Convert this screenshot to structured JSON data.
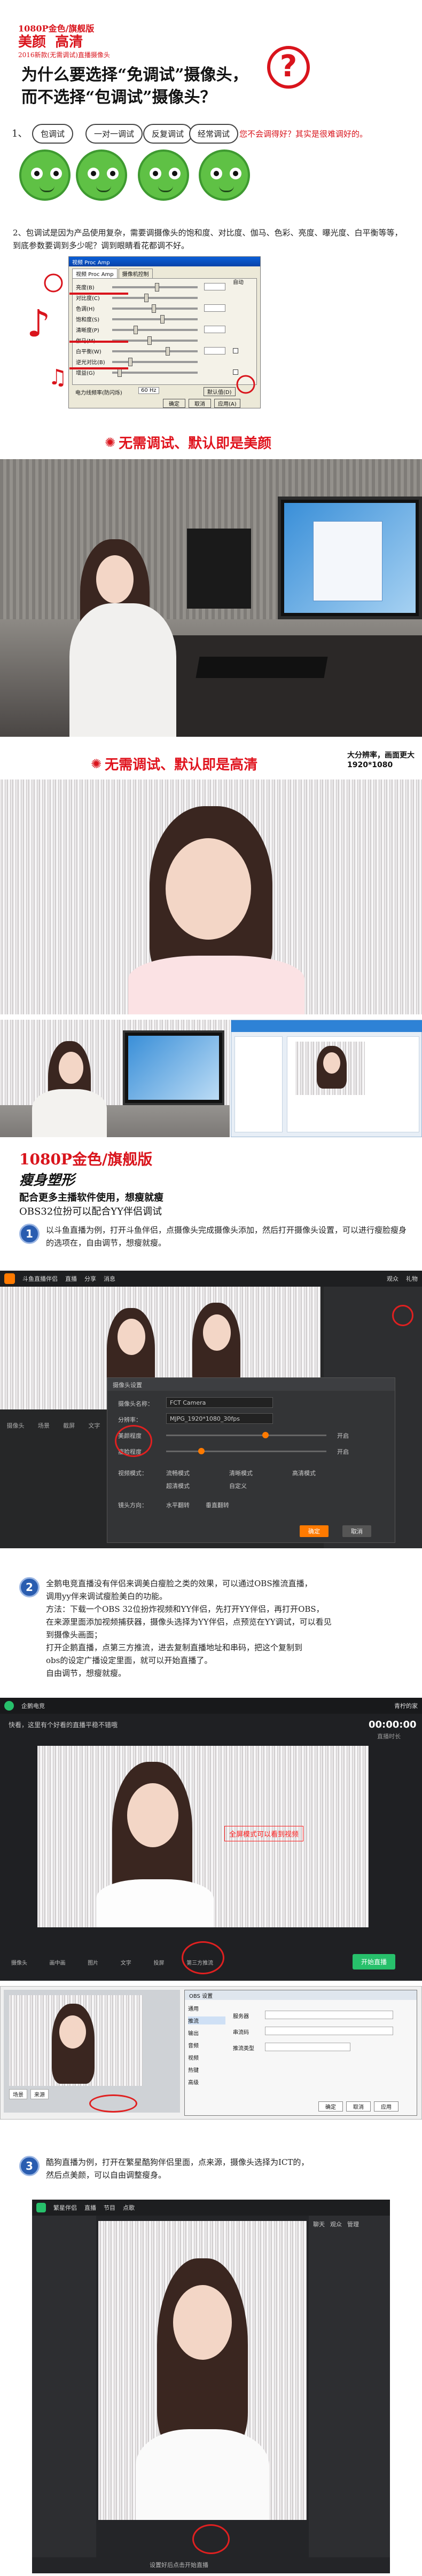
{
  "header": {
    "tag_line1": "1080P金色/旗舰版",
    "tag_line2_a": "美颜",
    "tag_line2_b": "高清",
    "tag_line3": "2016新款(无需调试)直播摄像头",
    "question_line1": "为什么要选择“免调试”摄像头，",
    "question_line2": "而不选择“包调试”摄像头？",
    "question_mark": "?"
  },
  "point1": {
    "number": "1、",
    "bubbles": [
      "包调试",
      "一对一调试",
      "反复调试",
      "经常调试"
    ],
    "side_text": "您不会调得好？其实是很难调好的。"
  },
  "point2": {
    "text": "2、包调试是因为产品使用复杂，需要调摄像头的饱和度、对比度、伽马、色彩、亮度、曝光度、白平衡等等，到底参数要调到多少呢？调到眼睛看花都调不好。"
  },
  "props_dialog": {
    "title": "视频 Proc Amp",
    "tabs": [
      "视频 Proc Amp",
      "摄像机控制"
    ],
    "rows": [
      "亮度(B)",
      "对比度(C)",
      "色调(H)",
      "饱和度(S)",
      "清晰度(P)",
      "伽马(M)",
      "白平衡(W)",
      "逆光对比(B)",
      "增益(G)"
    ],
    "auto_label": "自动",
    "footer_label": "电力线频率(防闪烁)",
    "footer_value": "60 Hz",
    "default_btn": "默认值(D)",
    "buttons": [
      "确定",
      "取消",
      "应用(A)"
    ]
  },
  "section_beauty": {
    "title": "无需调试、默认即是美颜"
  },
  "section_hd": {
    "title": "无需调试、默认即是高清",
    "note_line1": "大分辨率，画面更大",
    "note_line2": "1920*1080"
  },
  "product": {
    "line1": "1080P金色/旗舰版",
    "line2": "瘦身塑形",
    "line3": "配合更多主播软件使用，想瘦就瘦",
    "line4": "OBS32位扮可以配合YY伴侣调试"
  },
  "step1": {
    "number": "1",
    "text": "以斗鱼直播为例，打开斗鱼伴侣，点摄像头完成摄像头添加，然后打开摄像头设置，可以进行瘦脸瘦身的选项在，自由调节，想瘦就瘦。"
  },
  "douyu_app": {
    "app_name": "斗鱼直播伴侣",
    "tabs": [
      "直播",
      "分享",
      "消息"
    ],
    "right_tabs": [
      "观众",
      "礼物"
    ],
    "dialog_title": "摄像头设置",
    "device_label": "摄像头名称：",
    "device_value": "FCT Camera",
    "res_label": "分辨率：",
    "res_value": "MJPG_1920*1080_30fps",
    "rows": [
      "美颜程度",
      "瘦脸程度"
    ],
    "toggle_label": "开启",
    "mode_label": "视频模式：",
    "mode_options": [
      "流畅模式",
      "清晰模式",
      "高清模式",
      "超清模式",
      "自定义"
    ],
    "rotate_label": "镜头方向：",
    "rotate_options": [
      "水平翻转",
      "垂直翻转"
    ],
    "confirm": "确定",
    "cancel": "取消",
    "bottom_icons": [
      "摄像头",
      "场景",
      "截屏",
      "文字"
    ]
  },
  "step2": {
    "number": "2",
    "text_line1": "全鹅电竞直播没有伴侣来调美白瘦脸之类的效果，可以通过OBS推流直播，",
    "text_line2": "调用yy伴来调试瘦脸美白的功能。",
    "text_line3": "方法：下载一个OBS 32位扮炸视频和YY伴侣，先打开YY伴侣，再打开OBS，",
    "text_line4": "在来源里面添加视频捕获器，摄像头选择为YY伴侣，点预览在YY调试，可以看见",
    "text_line5": "到摄像头画面；",
    "text_line6": "打开企鹅直播，点第三方推流，进去复制直播地址和串码，把这个复制到",
    "text_line7": "obs的设定广播设定里面，就可以开始直播了。",
    "text_line8": "自由调节，想瘦就瘦。"
  },
  "penguin_app": {
    "app_name": "企鹅电竞",
    "user": "青柠的家",
    "notice": "快看，这里有个好看的直播平稳不错哦",
    "time": "00:00:00",
    "time_label": "直播时长",
    "overlay": "全屏模式可以看到视频",
    "start_btn": "开始直播",
    "bottom_icons": [
      "摄像头",
      "画中画",
      "图片",
      "文字",
      "投屏",
      "第三方推流"
    ]
  },
  "obs_app": {
    "title": "OBS 设置",
    "left_menu": [
      "通用",
      "推流",
      "输出",
      "音频",
      "视频",
      "热键",
      "高级"
    ],
    "tabs": [
      "场景",
      "来源"
    ],
    "fields": [
      "服务器",
      "串流码",
      "推流类型"
    ],
    "buttons": [
      "确定",
      "取消",
      "应用"
    ]
  },
  "step3": {
    "number": "3",
    "text_line1": "酷狗直播为例，打开在繁星酷狗伴侣里面，点来源，摄像头选择为ICT的，",
    "text_line2": "然后点美颜，可以自由调整瘦身。"
  },
  "kugou_app": {
    "app_name": "繁星伴侣",
    "tabs": [
      "直播",
      "节目",
      "点歌"
    ],
    "right_tabs": [
      "聊天",
      "观众",
      "管理"
    ],
    "status": "设置好后点击开始直播"
  },
  "colors": {
    "accent_red": "#d9141c",
    "blue_badge": "#2a5db0",
    "green_cat": "#5fc145",
    "douyu_orange": "#ff7a00",
    "penguin_green": "#27c06b"
  }
}
